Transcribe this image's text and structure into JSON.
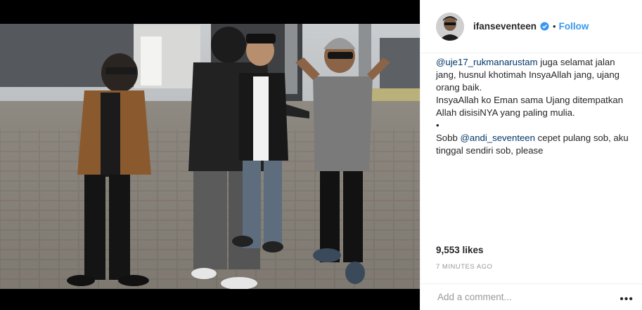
{
  "post": {
    "username": "ifanseventeen",
    "follow_label": "Follow",
    "caption": {
      "line1_mention": "@uje17_rukmanarustam",
      "line1_rest": " juga selamat jalan jang, husnul khotimah InsyaAllah jang, ujang orang baik.",
      "line2": "InsyaAllah ko Eman sama Ujang ditempatkan Allah disisiNYA yang paling mulia.",
      "bullet": "•",
      "line3_start": "Sobb ",
      "line3_mention": "@andi_seventeen",
      "line3_rest": " cepet pulang sob, aku tinggal sendiri sob, please"
    },
    "likes": "9,553 likes",
    "time": "7 MINUTES AGO",
    "comment_placeholder": "Add a comment...",
    "more_label": "•••"
  },
  "icons": {
    "verified": "verified-badge-icon",
    "more": "more-options-icon"
  },
  "colors": {
    "link": "#3897f0",
    "mention": "#003569",
    "meta": "#999999"
  }
}
